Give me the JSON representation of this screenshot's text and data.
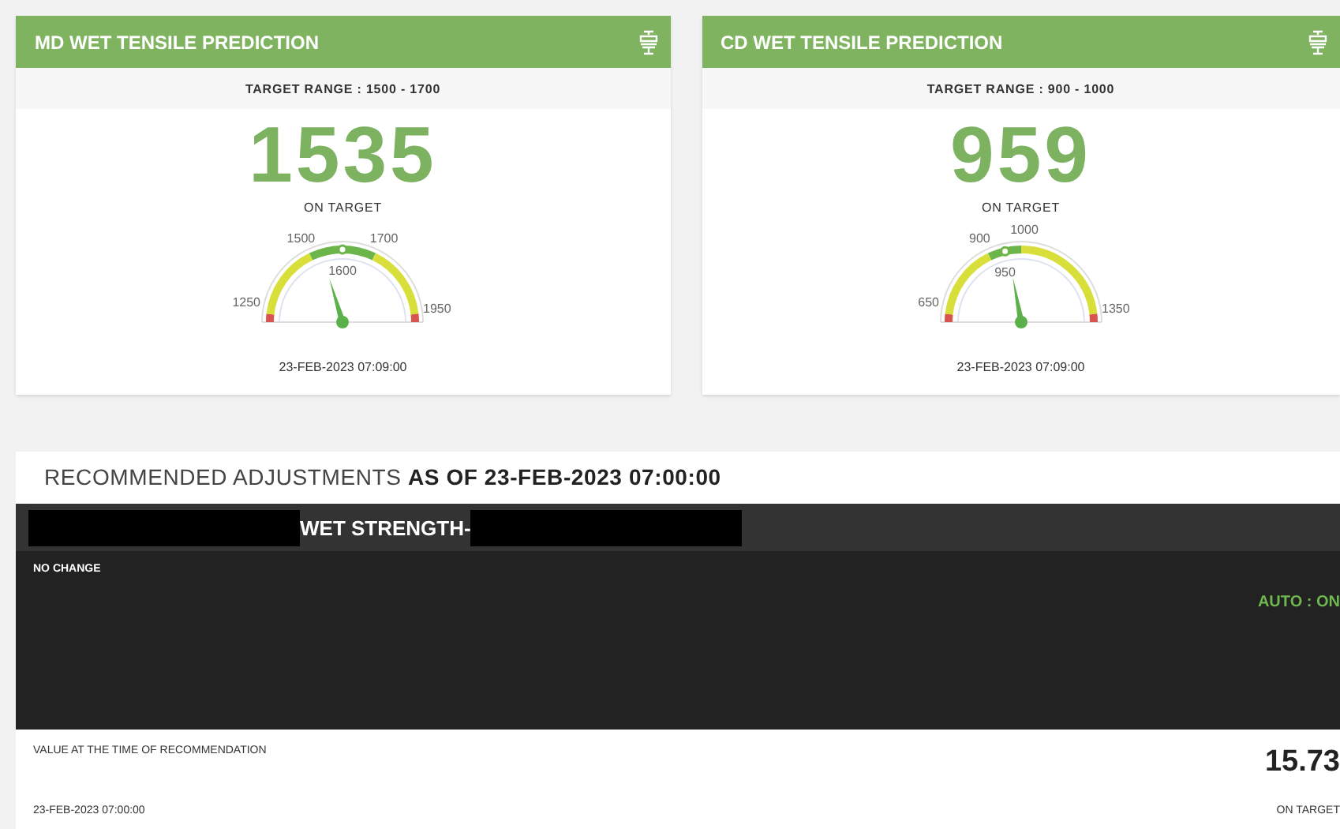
{
  "cards": [
    {
      "title": "MD WET TENSILE PREDICTION",
      "target_range": "TARGET RANGE : 1500 - 1700",
      "value": "1535",
      "status": "ON TARGET",
      "gauge": {
        "min": "1250",
        "low": "1500",
        "mid": "1600",
        "high": "1700",
        "max": "1950"
      },
      "timestamp": "23-FEB-2023 07:09:00"
    },
    {
      "title": "CD WET TENSILE PREDICTION",
      "target_range": "TARGET RANGE : 900 - 1000",
      "value": "959",
      "status": "ON TARGET",
      "gauge": {
        "min": "650",
        "low": "900",
        "mid": "950",
        "high": "1000",
        "max": "1350"
      },
      "timestamp": "23-FEB-2023 07:09:00"
    }
  ],
  "adjustments": {
    "title": "RECOMMENDED ADJUSTMENTS",
    "as_of": "AS OF  23-FEB-2023 07:00:00",
    "item_label": "WET STRENGTH-",
    "action": "NO CHANGE",
    "auto": "AUTO : ON",
    "value_label": "VALUE AT THE TIME OF RECOMMENDATION",
    "value": "15.73",
    "timestamp": "23-FEB-2023 07:00:00",
    "status": "ON TARGET"
  }
}
